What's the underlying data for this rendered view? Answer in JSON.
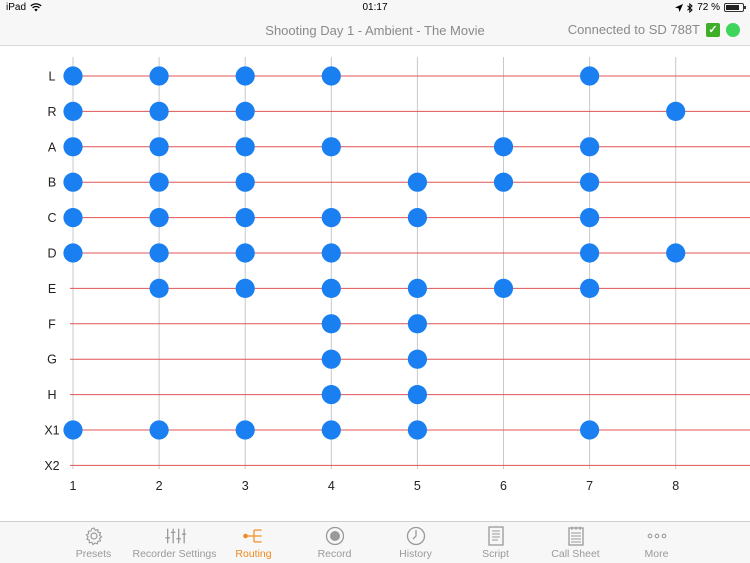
{
  "statusbar": {
    "device": "iPad",
    "time": "01:17",
    "battery_text": "72 %",
    "battery_level": 0.72
  },
  "header": {
    "title": "Shooting Day 1 - Ambient - The Movie",
    "connection_text": "Connected to SD 788T",
    "status_color": "#3dd65a"
  },
  "matrix": {
    "rows": [
      "L",
      "R",
      "A",
      "B",
      "C",
      "D",
      "E",
      "F",
      "G",
      "H",
      "X1",
      "X2"
    ],
    "columns": [
      "1",
      "2",
      "3",
      "4",
      "5",
      "6",
      "7",
      "8"
    ],
    "routes": {
      "L": [
        1,
        2,
        3,
        4,
        7
      ],
      "R": [
        1,
        2,
        3,
        8
      ],
      "A": [
        1,
        2,
        3,
        4,
        6,
        7
      ],
      "B": [
        1,
        2,
        3,
        5,
        6,
        7
      ],
      "C": [
        1,
        2,
        3,
        4,
        5,
        7
      ],
      "D": [
        1,
        2,
        3,
        4,
        7,
        8
      ],
      "E": [
        2,
        3,
        4,
        5,
        6,
        7
      ],
      "F": [
        4,
        5
      ],
      "G": [
        4,
        5
      ],
      "H": [
        4,
        5
      ],
      "X1": [
        1,
        2,
        3,
        4,
        5,
        7
      ],
      "X2": []
    },
    "colors": {
      "row_line": "#e05555",
      "col_line": "#c8c8c8",
      "dot": "#1a7ff0",
      "label": "#222222"
    }
  },
  "tabs": [
    {
      "label": "Presets",
      "icon": "gear-icon",
      "active": false
    },
    {
      "label": "Recorder Settings",
      "icon": "sliders-icon",
      "active": false
    },
    {
      "label": "Routing",
      "icon": "routing-icon",
      "active": true
    },
    {
      "label": "Record",
      "icon": "record-icon",
      "active": false
    },
    {
      "label": "History",
      "icon": "clock-icon",
      "active": false
    },
    {
      "label": "Script",
      "icon": "script-icon",
      "active": false
    },
    {
      "label": "Call Sheet",
      "icon": "call-sheet-icon",
      "active": false
    },
    {
      "label": "More",
      "icon": "more-icon",
      "active": false
    }
  ],
  "accent_color": "#f08a1c"
}
